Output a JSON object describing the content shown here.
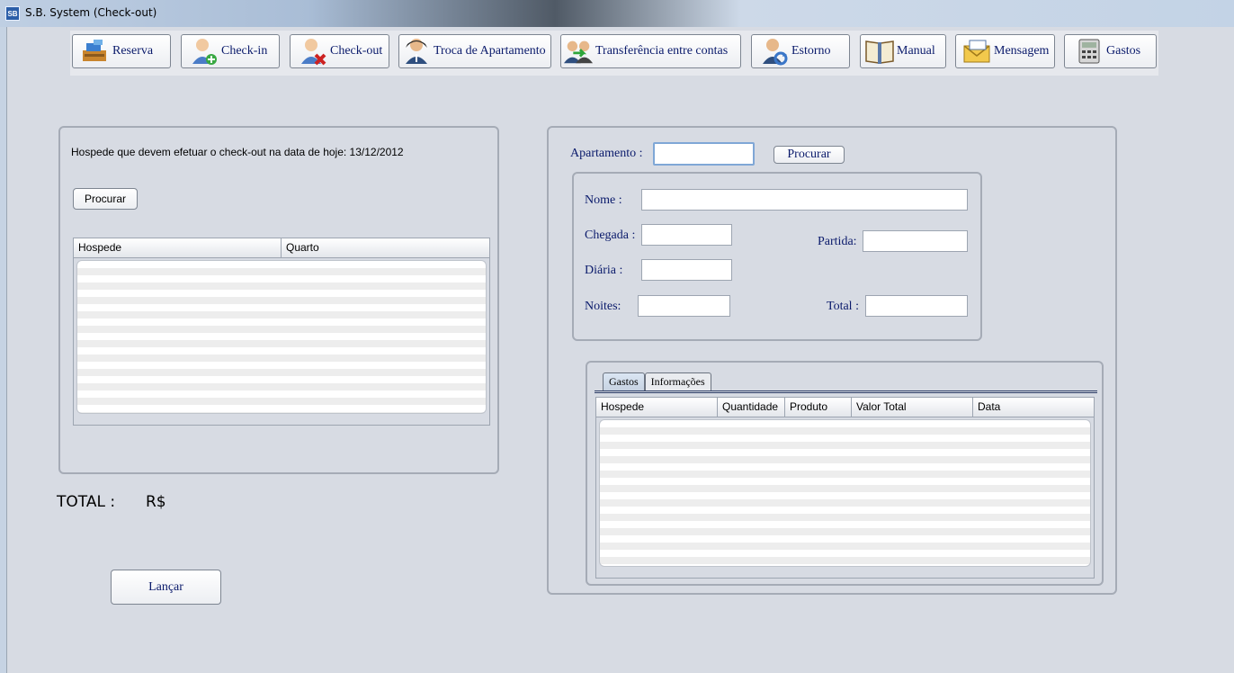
{
  "window": {
    "title": "S.B. System  (Check-out)",
    "icon_text": "SB"
  },
  "toolbar": {
    "buttons": [
      {
        "label": "Reserva",
        "icon": "cash-register-icon"
      },
      {
        "label": "Check-in",
        "icon": "user-add-icon"
      },
      {
        "label": "Check-out",
        "icon": "user-remove-icon"
      },
      {
        "label": "Troca de Apartamento",
        "icon": "user-exchange-icon"
      },
      {
        "label": "Transferência entre contas",
        "icon": "users-transfer-icon"
      },
      {
        "label": "Estorno",
        "icon": "user-refresh-icon"
      },
      {
        "label": "Manual",
        "icon": "book-icon"
      },
      {
        "label": "Mensagem",
        "icon": "envelope-icon"
      },
      {
        "label": "Gastos",
        "icon": "calculator-icon"
      }
    ]
  },
  "left_panel": {
    "heading": "Hospede que devem efetuar o check-out na data de hoje:  13/12/2012",
    "search_button": "Procurar",
    "table": {
      "columns": [
        "Hospede",
        "Quarto"
      ],
      "rows": []
    }
  },
  "total": {
    "label": "TOTAL :",
    "currency": "R$"
  },
  "launch_button": "Lançar",
  "right_panel": {
    "apartment_label": "Apartamento :",
    "apartment_value": "",
    "search_button": "Procurar",
    "fields": {
      "nome_label": "Nome :",
      "chegada_label": "Chegada :",
      "partida_label": "Partida:",
      "diaria_label": "Diária :",
      "noites_label": "Noites:",
      "total_label": "Total :"
    },
    "tabs": [
      "Gastos",
      "Informações"
    ],
    "active_tab": "Gastos",
    "table": {
      "columns": [
        "Hospede",
        "Quantidade",
        "Produto",
        "Valor Total",
        "Data"
      ],
      "rows": []
    }
  }
}
